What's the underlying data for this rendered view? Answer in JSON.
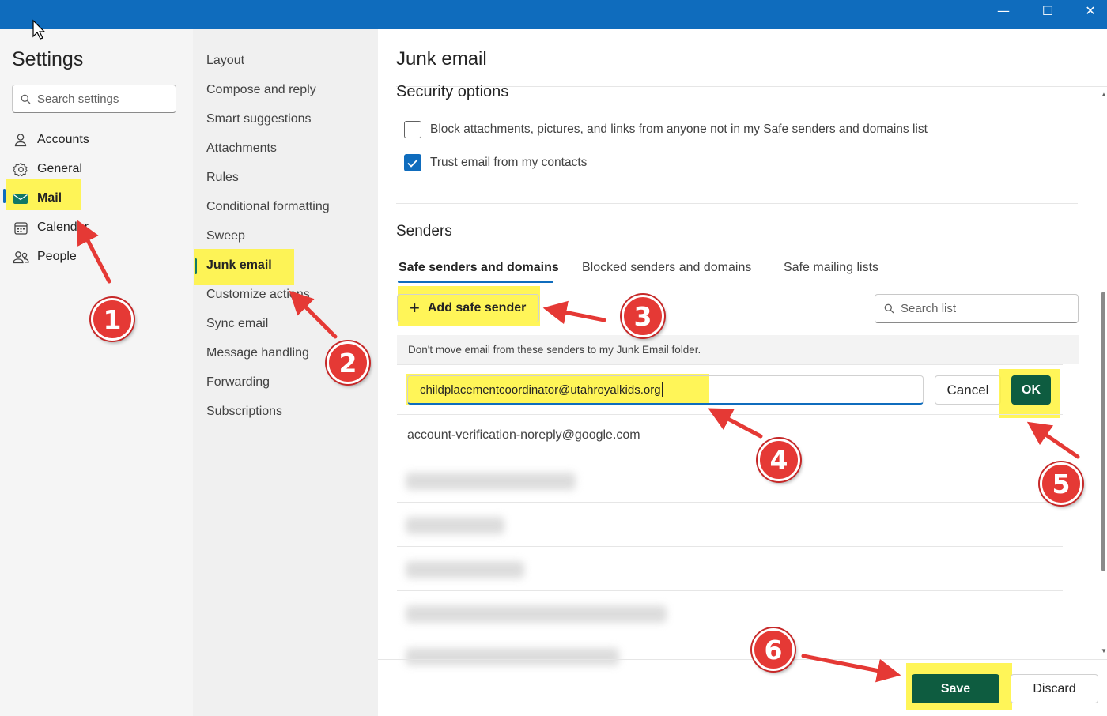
{
  "window": {
    "controls": {
      "minimize": "—",
      "maximize": "☐",
      "close": "✕"
    }
  },
  "settings": {
    "title": "Settings",
    "search_placeholder": "Search settings",
    "nav": [
      {
        "label": "Accounts",
        "icon": "person-icon"
      },
      {
        "label": "General",
        "icon": "gear-icon"
      },
      {
        "label": "Mail",
        "icon": "mail-icon",
        "selected": true
      },
      {
        "label": "Calendar",
        "icon": "calendar-icon"
      },
      {
        "label": "People",
        "icon": "people-icon"
      }
    ]
  },
  "mail_settings": {
    "items": [
      "Layout",
      "Compose and reply",
      "Smart suggestions",
      "Attachments",
      "Rules",
      "Conditional formatting",
      "Sweep",
      "Junk email",
      "Customize actions",
      "Sync email",
      "Message handling",
      "Forwarding",
      "Subscriptions"
    ],
    "selected": "Junk email"
  },
  "junk": {
    "title": "Junk email",
    "security_title": "Security options",
    "block_option": "Block attachments, pictures, and links from anyone not in my Safe senders and domains list",
    "block_checked": false,
    "trust_option": "Trust email from my contacts",
    "trust_checked": true,
    "senders_title": "Senders",
    "tabs": [
      "Safe senders and domains",
      "Blocked senders and domains",
      "Safe mailing lists"
    ],
    "active_tab": "Safe senders and domains",
    "add_button": "Add safe sender",
    "search_list_placeholder": "Search list",
    "info_text": "Don't move email from these senders to my Junk Email folder.",
    "input_value": "childplacementcoordinator@utahroyalkids.org",
    "cancel": "Cancel",
    "ok": "OK",
    "senders": [
      "account-verification-noreply@google.com"
    ],
    "save": "Save",
    "discard": "Discard"
  },
  "annotations": [
    "1",
    "2",
    "3",
    "4",
    "5",
    "6"
  ],
  "colors": {
    "titlebar": "#0f6cbd",
    "highlight": "#fff33b",
    "primary_button": "#0e5c40",
    "accent": "#0f6cbd",
    "annotation_red": "#e53935"
  }
}
